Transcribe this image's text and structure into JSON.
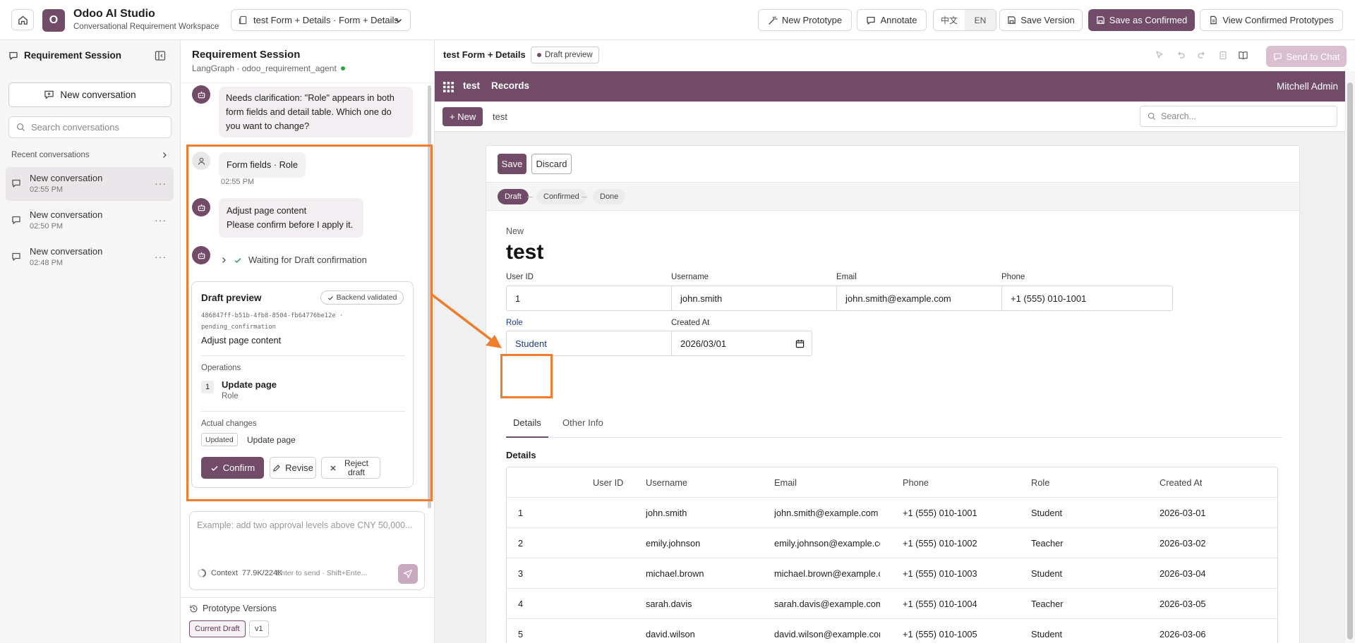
{
  "topbar": {
    "app_name": "Odoo AI Studio",
    "app_subtitle": "Conversational Requirement Workspace",
    "logo_letter": "O",
    "page_selector": "test Form + Details · Form + Details",
    "new_prototype": "New Prototype",
    "annotate": "Annotate",
    "lang_zh": "中文",
    "lang_en": "EN",
    "save_version": "Save Version",
    "save_confirmed": "Save as Confirmed",
    "view_confirmed": "View Confirmed Prototypes"
  },
  "sidebar": {
    "title": "Requirement Session",
    "new_conversation": "New conversation",
    "search_placeholder": "Search conversations",
    "recent_label": "Recent conversations",
    "conversations": [
      {
        "title": "New conversation",
        "time": "02:55 PM",
        "selected": true
      },
      {
        "title": "New conversation",
        "time": "02:50 PM",
        "selected": false
      },
      {
        "title": "New conversation",
        "time": "02:48 PM",
        "selected": false
      }
    ]
  },
  "chat": {
    "title": "Requirement Session",
    "subtitle": "LangGraph · odoo_requirement_agent",
    "msg_clarify": "Needs clarification: \"Role\" appears in both form fields and detail table. Which one do you want to change?",
    "msg_user": "Form fields · Role",
    "msg_user_time": "02:55 PM",
    "msg_bot_1": "Adjust page content",
    "msg_bot_2": "Please confirm before I apply it.",
    "waiting": "Waiting for Draft confirmation",
    "card": {
      "title": "Draft preview",
      "badge": "Backend validated",
      "hash": "486847ff-b51b-4fb8-8504-fb64776be12e · pending_confirmation",
      "action": "Adjust page content",
      "operations_label": "Operations",
      "op_number": "1",
      "op_title": "Update page",
      "op_sub": "Role",
      "changes_label": "Actual changes",
      "change_tag": "Updated",
      "change_text": "Update page",
      "confirm": "Confirm",
      "revise": "Revise",
      "reject": "Reject draft"
    },
    "input_placeholder": "Example: add two approval levels above CNY 50,000...",
    "context_label": "Context",
    "context_value": "77.9K/224K",
    "send_hint": "Enter to send · Shift+Ente...",
    "versions_title": "Prototype Versions",
    "version_current": "Current Draft",
    "version_v1": "v1"
  },
  "preview_header": {
    "title": "test Form + Details",
    "badge": "Draft preview",
    "send_to_chat": "Send to Chat"
  },
  "odoo": {
    "app": "test",
    "menu": "Records",
    "user": "Mitchell Admin",
    "new_button": "+ New",
    "breadcrumb": "test",
    "search_placeholder": "Search...",
    "save": "Save",
    "discard": "Discard",
    "stages": [
      "Draft",
      "Confirmed",
      "Done"
    ],
    "record_state": "New",
    "record_name": "test",
    "fields": {
      "user_id_label": "User ID",
      "user_id": "1",
      "username_label": "Username",
      "username": "john.smith",
      "email_label": "Email",
      "email": "john.smith@example.com",
      "phone_label": "Phone",
      "phone": "+1 (555) 010-1001",
      "role_label": "Role",
      "role": "Student",
      "created_label": "Created At",
      "created": "2026/03/01"
    },
    "tabs": [
      "Details",
      "Other Info"
    ],
    "details_heading": "Details",
    "table": {
      "headers": [
        "User ID",
        "Username",
        "Email",
        "Phone",
        "Role",
        "Created At"
      ],
      "rows": [
        [
          "1",
          "john.smith",
          "john.smith@example.com",
          "+1 (555) 010-1001",
          "Student",
          "2026-03-01"
        ],
        [
          "2",
          "emily.johnson",
          "emily.johnson@example.com",
          "+1 (555) 010-1002",
          "Teacher",
          "2026-03-02"
        ],
        [
          "3",
          "michael.brown",
          "michael.brown@example.com",
          "+1 (555) 010-1003",
          "Student",
          "2026-03-04"
        ],
        [
          "4",
          "sarah.davis",
          "sarah.davis@example.com",
          "+1 (555) 010-1004",
          "Teacher",
          "2026-03-05"
        ],
        [
          "5",
          "david.wilson",
          "david.wilson@example.com",
          "+1 (555) 010-1005",
          "Student",
          "2026-03-06"
        ]
      ]
    }
  },
  "colors": {
    "brand": "#714b67",
    "annotation": "#f07d2d"
  }
}
